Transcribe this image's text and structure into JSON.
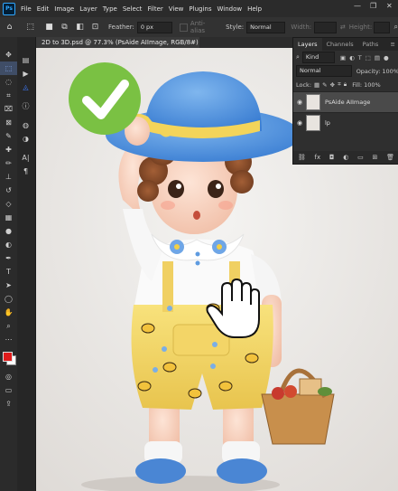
{
  "app": {
    "logo": "Ps"
  },
  "menu": [
    "File",
    "Edit",
    "Image",
    "Layer",
    "Type",
    "Select",
    "Filter",
    "View",
    "Plugins",
    "Window",
    "Help"
  ],
  "window_controls": {
    "minimize": "—",
    "maximize": "❐",
    "close": "✕"
  },
  "options": {
    "feather_label": "Feather:",
    "feather_value": "0 px",
    "antialias_label": "Anti-alias",
    "style_label": "Style:",
    "style_value": "Normal",
    "width_label": "Width:",
    "height_label": "Height:"
  },
  "document": {
    "tab_title": "2D to 3D.psd @ 77.3% (PsAide AIImage, RGB/8#) *",
    "tab_close": "×"
  },
  "layers_panel": {
    "tabs": [
      "Layers",
      "Channels",
      "Paths"
    ],
    "menu_icon": "≡",
    "filter_label": "Kind",
    "blend_mode": "Normal",
    "opacity_label": "Opacity:",
    "opacity_value": "100%",
    "lock_label": "Lock:",
    "fill_label": "Fill:",
    "fill_value": "100%",
    "layers": [
      {
        "name": "PsAide AIImage",
        "selected": true
      },
      {
        "name": "lp",
        "selected": false
      }
    ],
    "footer_icons": [
      "link-icon",
      "fx-icon",
      "mask-icon",
      "adjustment-icon",
      "folder-icon",
      "new-layer-icon",
      "trash-icon"
    ],
    "fx_label": "fx"
  },
  "colors": {
    "foreground": "#e01b1b",
    "background": "#ffffff",
    "checkmark": "#7ac143",
    "accent": "#31a8ff"
  }
}
